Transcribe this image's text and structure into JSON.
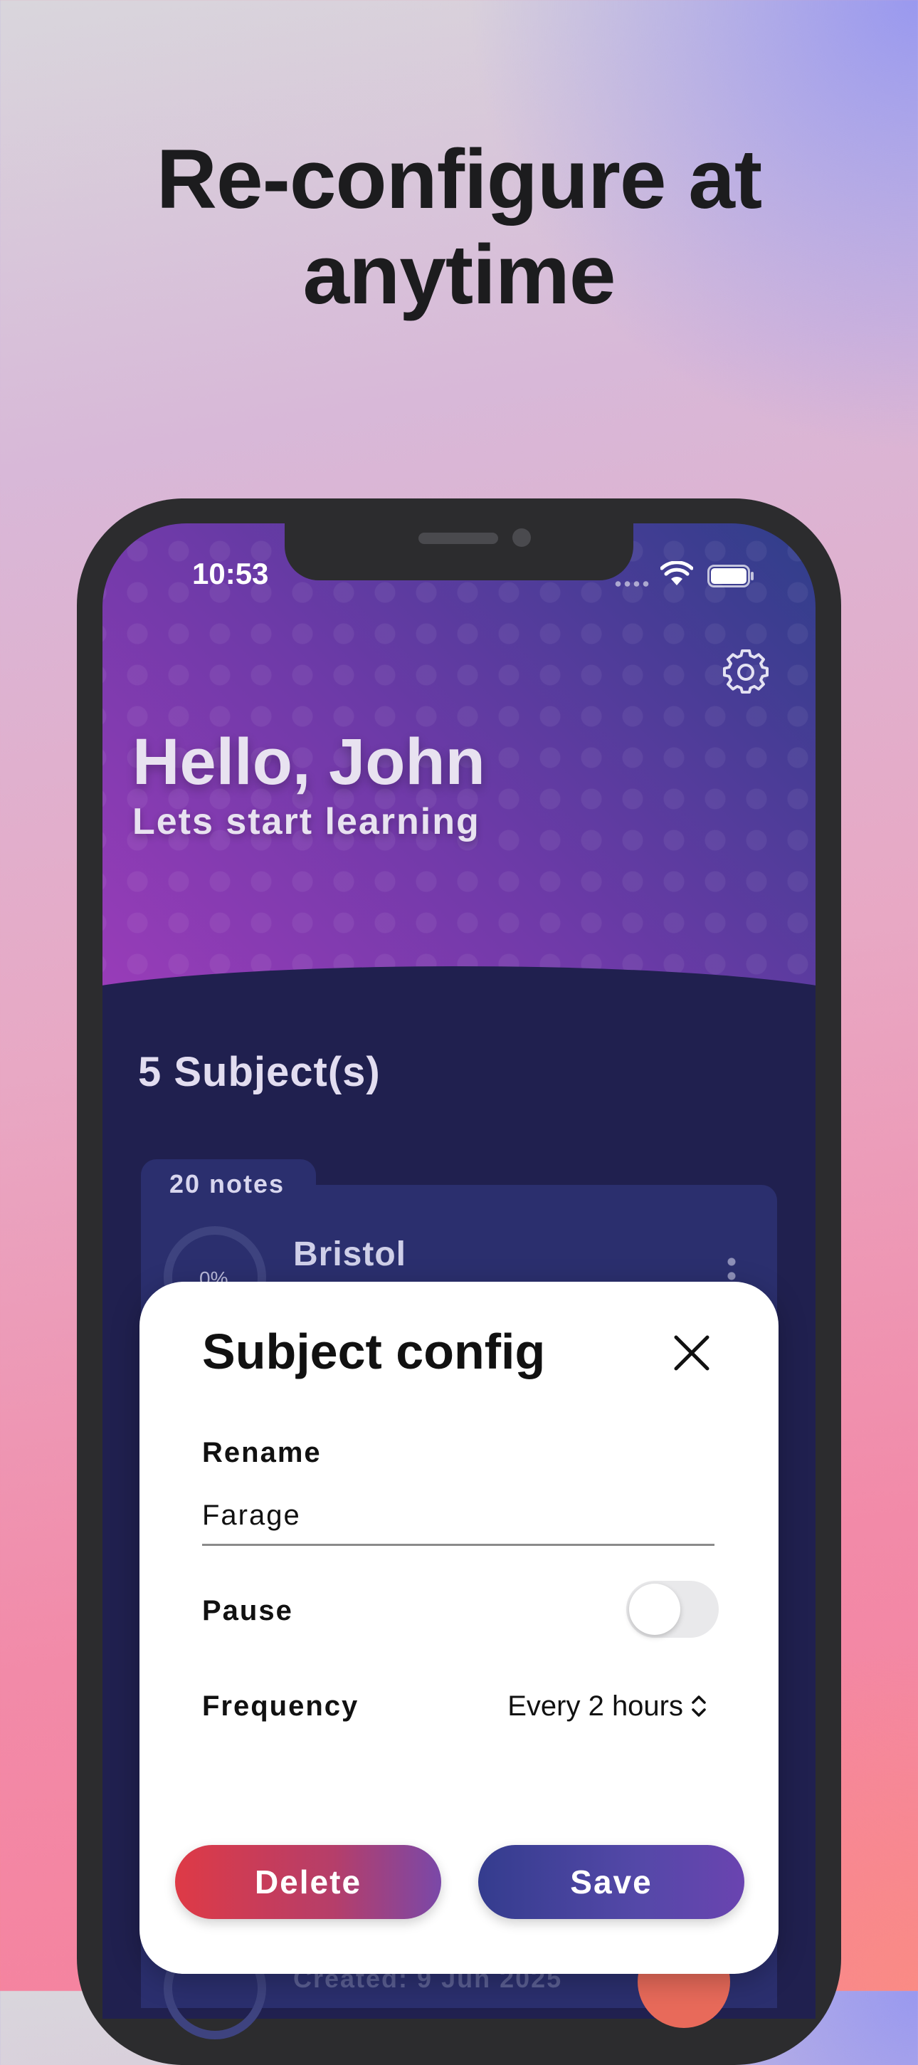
{
  "headline": {
    "line1": "Re-configure at",
    "line2": "anytime"
  },
  "status_bar": {
    "time": "10:53"
  },
  "home": {
    "greeting": "Hello, John",
    "subtitle": "Lets start learning",
    "subjects_count": "5 Subject(s)",
    "cards": [
      {
        "notes": "20 notes",
        "progress": "0%",
        "title": "Bristol"
      },
      {
        "created": "Created: 9 Jun 2025"
      }
    ]
  },
  "modal": {
    "title": "Subject config",
    "rename_label": "Rename",
    "rename_value": "Farage",
    "pause_label": "Pause",
    "pause_on": false,
    "frequency_label": "Frequency",
    "frequency_value": "Every 2 hours",
    "delete_label": "Delete",
    "save_label": "Save"
  },
  "colors": {
    "hero_start": "#9a3cb9",
    "hero_end": "#2f3e8a",
    "screen_bg": "#20204f",
    "card_bg": "#2b2f6e",
    "delete_start": "#de3a46",
    "save_start": "#343c8e"
  },
  "icons": {
    "settings": "gear-icon",
    "close": "close-icon",
    "frequency": "chevron-up-down-icon"
  }
}
